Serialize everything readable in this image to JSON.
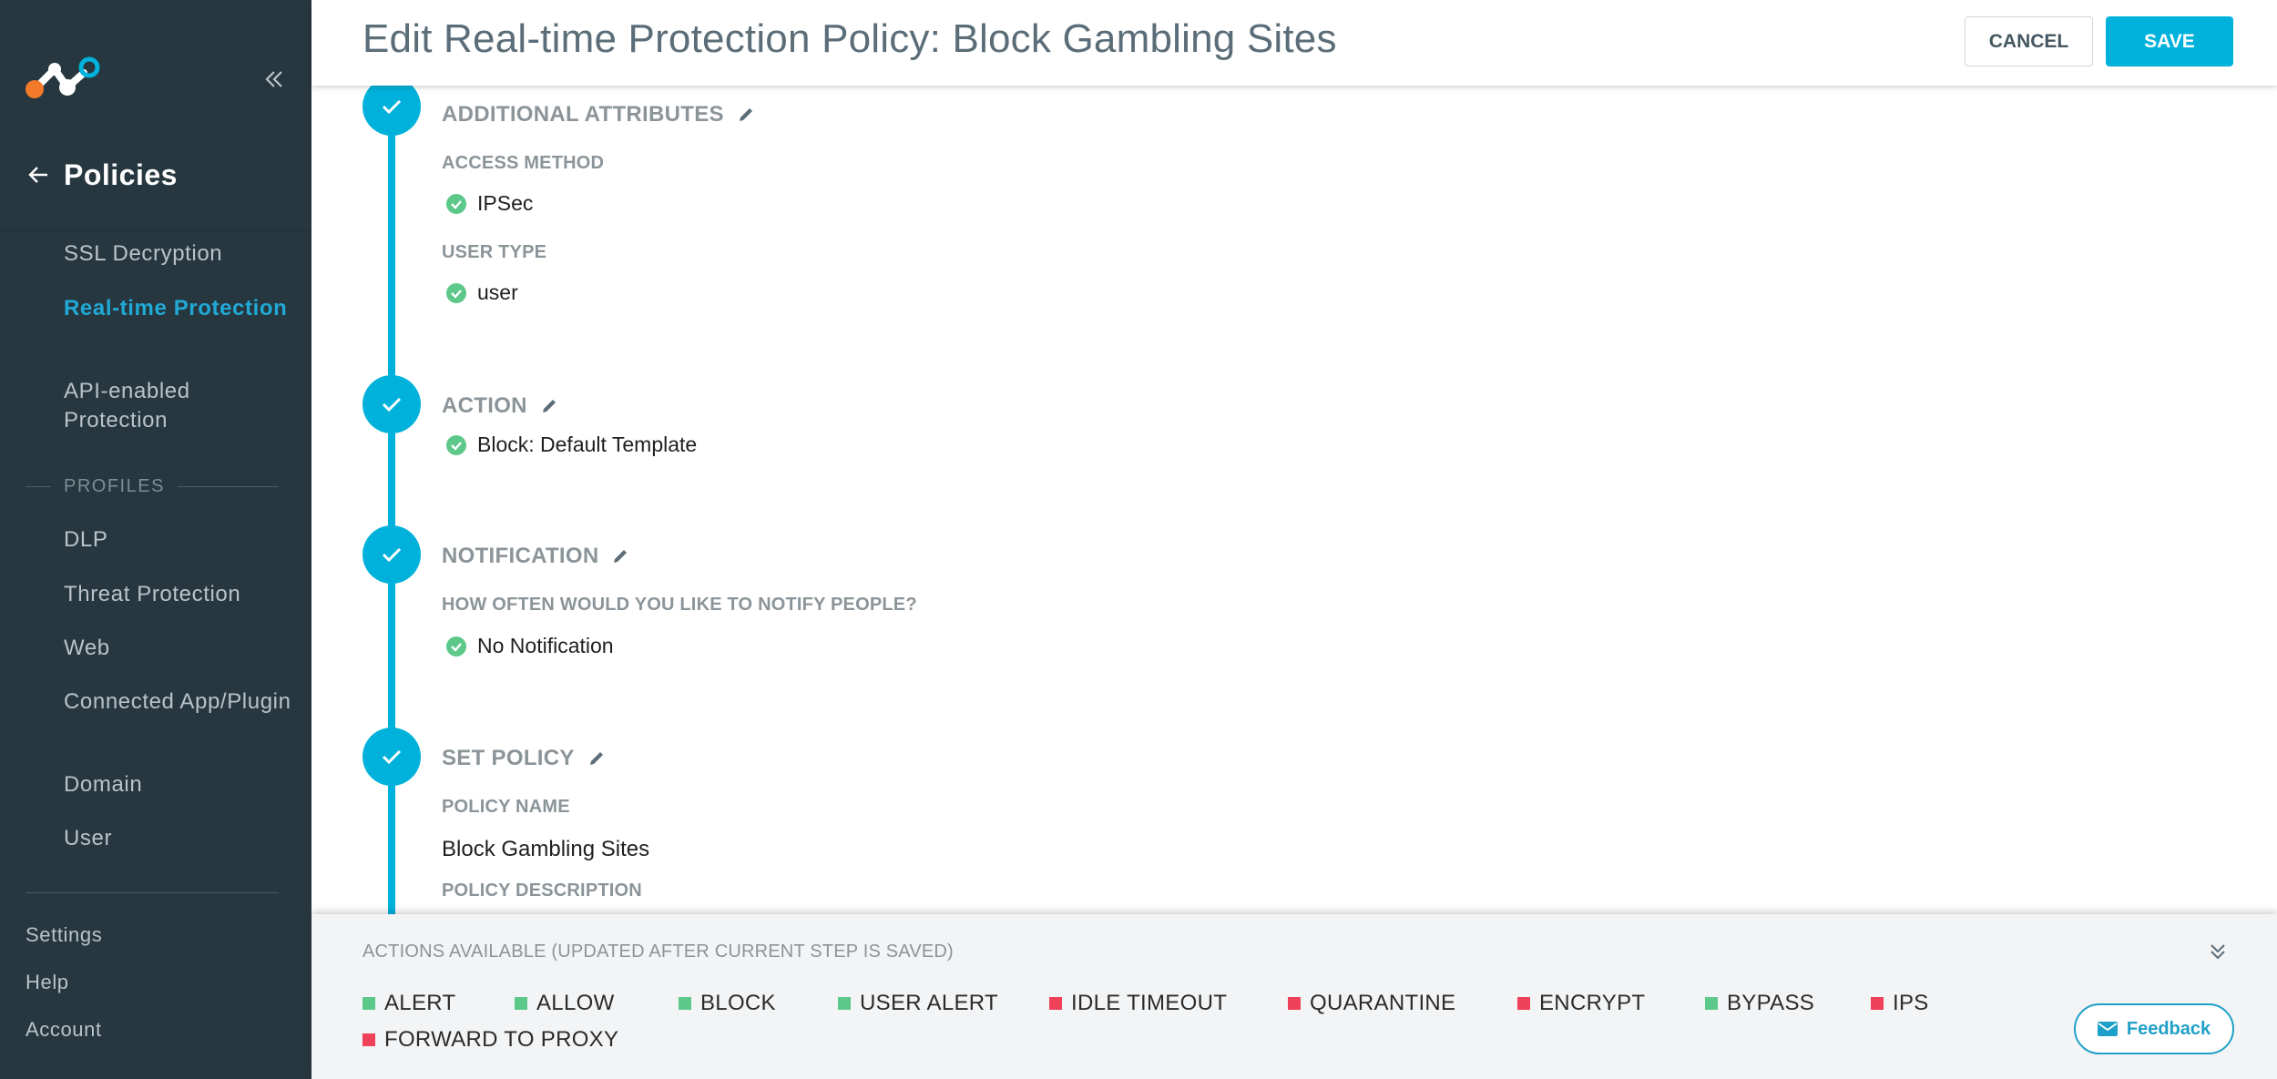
{
  "sidebar": {
    "back_title": "Policies",
    "items": [
      {
        "label": "SSL Decryption"
      },
      {
        "label": "Real-time Protection",
        "active": true
      },
      {
        "label": "API-enabled Protection"
      }
    ],
    "section_label": "PROFILES",
    "profiles": [
      {
        "label": "DLP"
      },
      {
        "label": "Threat Protection"
      },
      {
        "label": "Web"
      },
      {
        "label": "Connected App/Plugin"
      },
      {
        "label": "Domain"
      },
      {
        "label": "User"
      }
    ],
    "bottom": [
      {
        "label": "Settings"
      },
      {
        "label": "Help"
      },
      {
        "label": "Account"
      }
    ]
  },
  "header": {
    "title": "Edit Real-time Protection Policy: Block Gambling Sites",
    "cancel_label": "CANCEL",
    "save_label": "SAVE"
  },
  "steps": {
    "additional": {
      "title": "ADDITIONAL ATTRIBUTES",
      "access_method_label": "ACCESS METHOD",
      "access_method_value": "IPSec",
      "user_type_label": "USER TYPE",
      "user_type_value": "user"
    },
    "action": {
      "title": "ACTION",
      "value": "Block: Default Template"
    },
    "notification": {
      "title": "NOTIFICATION",
      "question": "HOW OFTEN WOULD YOU LIKE TO NOTIFY PEOPLE?",
      "value": "No Notification"
    },
    "set_policy": {
      "title": "SET POLICY",
      "name_label": "POLICY NAME",
      "name_value": "Block Gambling Sites",
      "description_label": "POLICY DESCRIPTION"
    }
  },
  "actions_panel": {
    "title": "ACTIONS AVAILABLE (UPDATED AFTER CURRENT STEP IS SAVED)",
    "actions": [
      {
        "label": "ALERT",
        "status": "available"
      },
      {
        "label": "ALLOW",
        "status": "available"
      },
      {
        "label": "BLOCK",
        "status": "available"
      },
      {
        "label": "USER ALERT",
        "status": "available"
      },
      {
        "label": "IDLE TIMEOUT",
        "status": "unavailable"
      },
      {
        "label": "QUARANTINE",
        "status": "unavailable"
      },
      {
        "label": "ENCRYPT",
        "status": "unavailable"
      },
      {
        "label": "BYPASS",
        "status": "available"
      },
      {
        "label": "IPS",
        "status": "unavailable"
      },
      {
        "label": "FORWARD TO PROXY",
        "status": "unavailable"
      }
    ],
    "feedback_label": "Feedback"
  },
  "colors": {
    "sidebar_bg": "#27373f",
    "accent": "#00b2db",
    "available": "#5cc98a",
    "unavailable": "#f0415a",
    "active_nav": "#21a9d6"
  },
  "icons": {
    "logo": "netskope-logo",
    "collapse": "double-chevron-left-icon",
    "back": "arrow-left-icon",
    "step_done": "check-icon",
    "edit": "pencil-icon",
    "value_ok": "check-circle-icon",
    "panel_toggle": "double-chevron-down-icon",
    "feedback": "envelope-icon"
  }
}
